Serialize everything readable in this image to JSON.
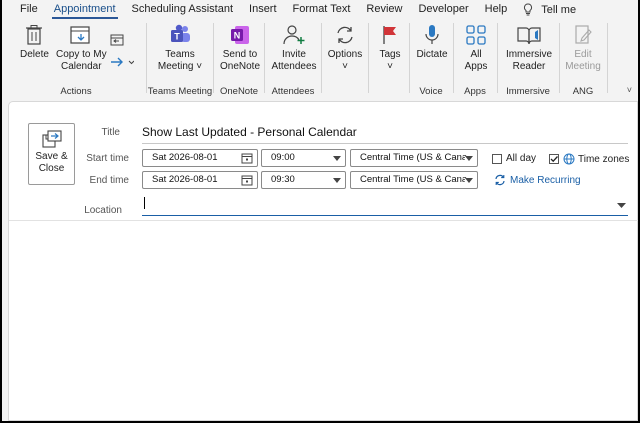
{
  "menu": {
    "tabs": [
      "File",
      "Appointment",
      "Scheduling Assistant",
      "Insert",
      "Format Text",
      "Review",
      "Developer",
      "Help"
    ],
    "active": "Appointment",
    "tellme": "Tell me"
  },
  "ribbon": {
    "actions": {
      "delete": "Delete",
      "copy1": "Copy to My",
      "copy2": "Calendar",
      "label": "Actions"
    },
    "teams": {
      "l1": "Teams",
      "l2": "Meeting",
      "label": "Teams Meeting"
    },
    "onenote": {
      "l1": "Send to",
      "l2": "OneNote",
      "label": "OneNote"
    },
    "attendees": {
      "l1": "Invite",
      "l2": "Attendees",
      "label": "Attendees"
    },
    "options": {
      "l1": "Options"
    },
    "tags": {
      "l1": "Tags"
    },
    "voice": {
      "l1": "Dictate",
      "label": "Voice"
    },
    "apps": {
      "l1": "All",
      "l2": "Apps",
      "label": "Apps"
    },
    "immersive": {
      "l1": "Immersive",
      "l2": "Reader",
      "label": "Immersive"
    },
    "ang": {
      "l1": "Edit",
      "l2": "Meeting",
      "label": "ANG"
    }
  },
  "form": {
    "save1": "Save &",
    "save2": "Close",
    "title_label": "Title",
    "title_value": "Show Last Updated - Personal Calendar",
    "start_label": "Start time",
    "start_date": "Sat 2026-08-01",
    "start_time": "09:00",
    "start_tz": "Central Time (US & Cana",
    "end_label": "End time",
    "end_date": "Sat 2026-08-01",
    "end_time": "09:30",
    "end_tz": "Central Time (US & Cana",
    "allday": "All day",
    "timezones": "Time zones",
    "recurring": "Make Recurring",
    "location_label": "Location",
    "location_value": ""
  },
  "colors": {
    "accent": "#2b5797",
    "link": "#1a5fa6",
    "teams": "#5059c9",
    "onenote": "#7719aa",
    "tags": "#d13438"
  }
}
